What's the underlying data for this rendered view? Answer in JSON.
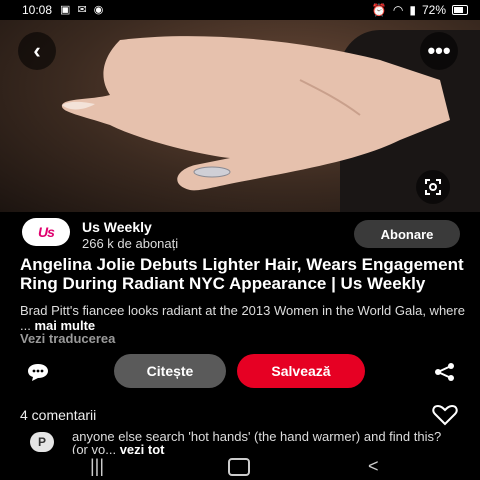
{
  "status_bar": {
    "time": "10:08",
    "battery": "72%"
  },
  "publisher": {
    "logo_text": "Us",
    "name": "Us Weekly",
    "subscribers": "266 k de abonați",
    "follow_label": "Abonare"
  },
  "pin": {
    "title": "Angelina Jolie Debuts Lighter Hair, Wears Engagement Ring During Radiant NYC Appearance | Us Weekly",
    "description": "Brad Pitt's fiancee looks radiant at the 2013 Women in the World Gala, where ...",
    "more_label": "mai multe",
    "translate_label": "Vezi traducerea"
  },
  "actions": {
    "read_label": "Citește",
    "save_label": "Salvează"
  },
  "comments": {
    "count_label": "4 comentarii",
    "first": {
      "avatar_letter": "P",
      "text": "anyone else search 'hot hands' (the hand warmer) and find this? (or vo...",
      "more_label": "vezi tot"
    }
  },
  "nav": {
    "recent": "|||",
    "back": "<"
  },
  "colors": {
    "save": "#e60023",
    "read": "#5a5a5a",
    "follow": "#3a3a3a"
  }
}
